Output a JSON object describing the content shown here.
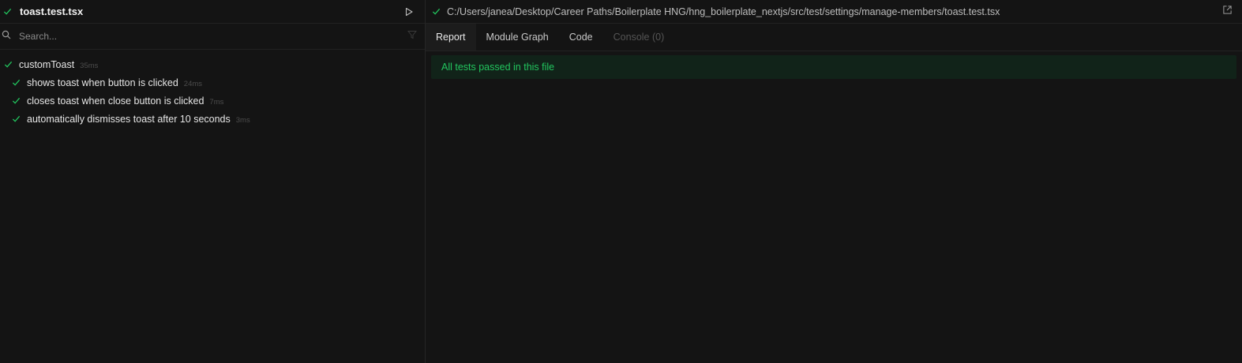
{
  "explorer": {
    "file_name": "toast.test.tsx",
    "search_placeholder": "Search...",
    "suite": {
      "name": "customToast",
      "duration": "35ms"
    },
    "tests": [
      {
        "name": "shows toast when button is clicked",
        "duration": "24ms"
      },
      {
        "name": "closes toast when close button is clicked",
        "duration": "7ms"
      },
      {
        "name": "automatically dismisses toast after 10 seconds",
        "duration": "3ms"
      }
    ]
  },
  "detail": {
    "path": "C:/Users/janea/Desktop/Career Paths/Boilerplate HNG/hng_boilerplate_nextjs/src/test/settings/manage-members/toast.test.tsx",
    "tabs": [
      "Report",
      "Module Graph",
      "Code",
      "Console (0)"
    ],
    "active_tab": "Report",
    "status_message": "All tests passed in this file"
  },
  "colors": {
    "background": "#141414",
    "pass_green": "#22c55e",
    "banner_bg": "#112319"
  },
  "icons": [
    "check-icon",
    "play-icon",
    "search-icon",
    "filter-icon",
    "external-link-icon"
  ]
}
